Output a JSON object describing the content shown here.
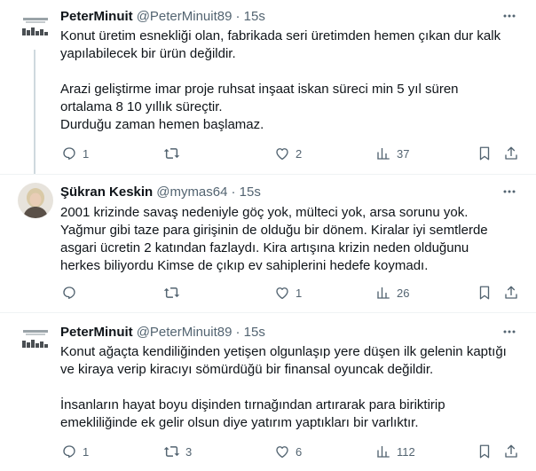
{
  "tweets": [
    {
      "name": "PeterMinuit",
      "handle": "@PeterMinuit89",
      "time": "· 15s",
      "lines": [
        "Konut üretim esnekliği olan, fabrikada seri üretimden hemen çıkan dur kalk",
        "yapılabilecek bir ürün değildir.",
        "",
        "Arazi geliştirme imar proje ruhsat inşaat iskan süreci min 5 yıl süren",
        "ortalama 8 10 yıllık süreçtir.",
        "Durduğu zaman hemen başlamaz."
      ],
      "replies": "1",
      "retweets": "",
      "likes": "2",
      "views": "37"
    },
    {
      "name": "Şükran Keskin",
      "handle": "@mymas64",
      "time": "· 15s",
      "lines": [
        "2001 krizinde savaş nedeniyle göç yok, mülteci yok, arsa sorunu yok.",
        "Yağmur gibi taze para girişinin de olduğu bir dönem. Kiralar iyi semtlerde",
        "asgari ücretin 2 katından fazlaydı. Kira artışına krizin neden olduğunu",
        "herkes biliyordu Kimse de çıkıp ev sahiplerini hedefe koymadı."
      ],
      "replies": "",
      "retweets": "",
      "likes": "1",
      "views": "26"
    },
    {
      "name": "PeterMinuit",
      "handle": "@PeterMinuit89",
      "time": "· 15s",
      "lines": [
        "Konut ağaçta kendiliğinden yetişen olgunlaşıp yere düşen ilk gelenin kaptığı",
        "ve kiraya verip kiracıyı sömürdüğü bir finansal oyuncak değildir.",
        "",
        "İnsanların hayat boyu dişinden tırnağından artırarak para biriktirip",
        "emekliliğinde ek gelir olsun diye yatırım yaptıkları bir varlıktır."
      ],
      "replies": "1",
      "retweets": "3",
      "likes": "6",
      "views": "112"
    }
  ],
  "icons": {
    "reply": "reply-icon",
    "retweet": "retweet-icon",
    "like": "heart-icon",
    "views": "views-icon",
    "bookmark": "bookmark-icon",
    "share": "share-icon",
    "more": "more-icon"
  },
  "colors": {
    "text": "#0f1419",
    "secondary": "#536471",
    "divider": "#eff3f4",
    "thread": "#cfd9de"
  }
}
